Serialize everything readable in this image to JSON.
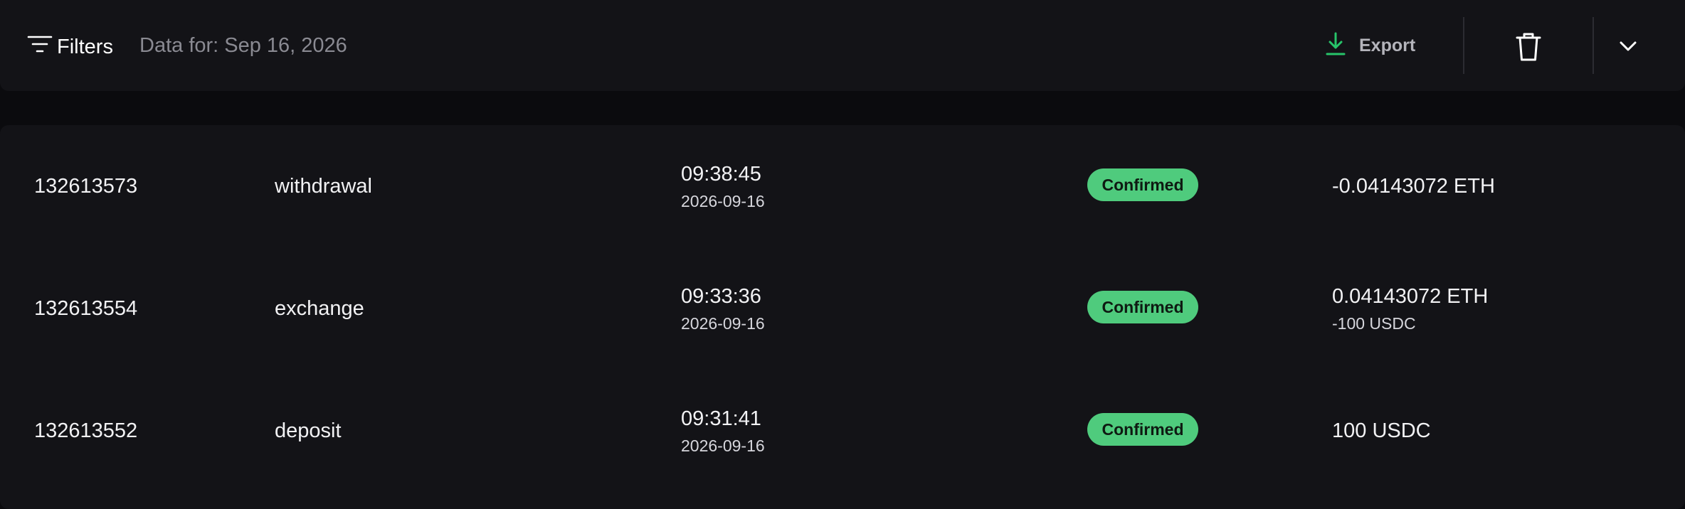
{
  "toolbar": {
    "filters_label": "Filters",
    "data_for": "Data for: Sep 16, 2026",
    "export_label": "Export"
  },
  "colors": {
    "background": "#0b0b0e",
    "panel": "#131317",
    "accent_green": "#4fcb7d",
    "export_icon": "#27c46a",
    "muted_text": "#8a8a92"
  },
  "transactions": [
    {
      "id": "132613573",
      "type": "withdrawal",
      "time": "09:38:45",
      "date": "2026-09-16",
      "status": "Confirmed",
      "amount": "-0.04143072 ETH",
      "amount_secondary": ""
    },
    {
      "id": "132613554",
      "type": "exchange",
      "time": "09:33:36",
      "date": "2026-09-16",
      "status": "Confirmed",
      "amount": "0.04143072 ETH",
      "amount_secondary": "-100 USDC"
    },
    {
      "id": "132613552",
      "type": "deposit",
      "time": "09:31:41",
      "date": "2026-09-16",
      "status": "Confirmed",
      "amount": "100 USDC",
      "amount_secondary": ""
    }
  ]
}
